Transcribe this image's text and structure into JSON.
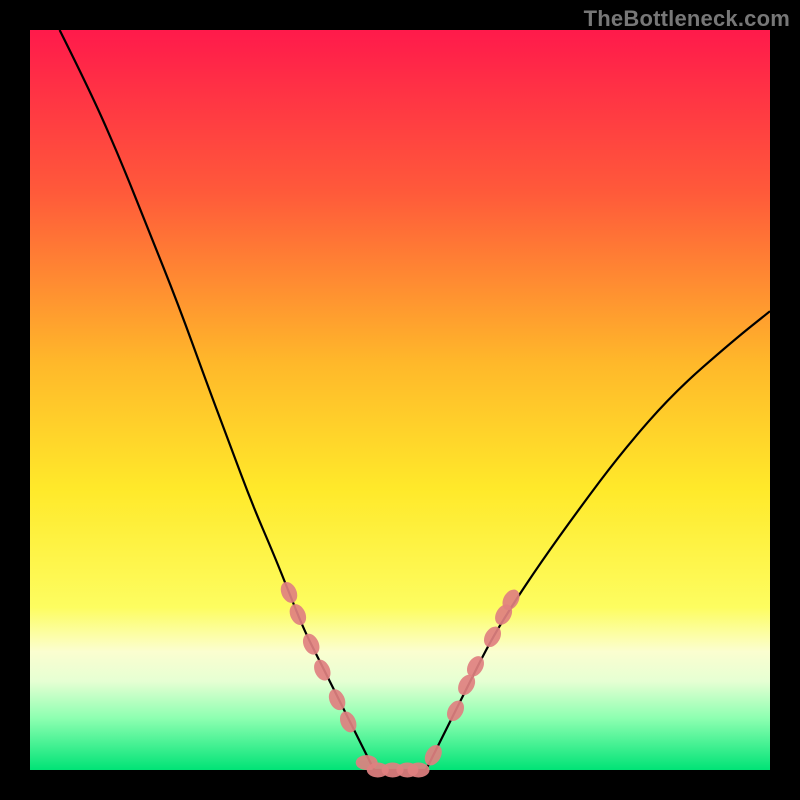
{
  "watermark": "TheBottleneck.com",
  "chart_data": {
    "type": "line",
    "title": "",
    "xlabel": "",
    "ylabel": "",
    "xlim": [
      0,
      100
    ],
    "ylim": [
      0,
      100
    ],
    "grid": false,
    "legend": false,
    "background_gradient": {
      "stops": [
        {
          "offset": 0.0,
          "color": "#ff1a4b"
        },
        {
          "offset": 0.22,
          "color": "#ff5a3a"
        },
        {
          "offset": 0.45,
          "color": "#ffb82a"
        },
        {
          "offset": 0.62,
          "color": "#ffe92a"
        },
        {
          "offset": 0.78,
          "color": "#fdfd60"
        },
        {
          "offset": 0.84,
          "color": "#fbfed0"
        },
        {
          "offset": 0.88,
          "color": "#e6ffd3"
        },
        {
          "offset": 0.93,
          "color": "#8dffb1"
        },
        {
          "offset": 1.0,
          "color": "#00e376"
        }
      ]
    },
    "series": [
      {
        "name": "left-curve",
        "color": "#000000",
        "x": [
          4,
          8,
          12,
          16,
          20,
          24,
          27,
          30,
          33,
          35,
          37,
          39,
          41,
          43,
          45,
          46.5
        ],
        "y": [
          100,
          92,
          83,
          73,
          63,
          52,
          44,
          36,
          29,
          24,
          19,
          15,
          11,
          7,
          3,
          0
        ]
      },
      {
        "name": "right-curve",
        "color": "#000000",
        "x": [
          53.5,
          55,
          57,
          59,
          62,
          65,
          69,
          74,
          80,
          87,
          95,
          100
        ],
        "y": [
          0,
          3,
          7,
          11,
          17,
          22,
          28,
          35,
          43,
          51,
          58,
          62
        ]
      },
      {
        "name": "valley-floor",
        "color": "#000000",
        "x": [
          46.5,
          53.5
        ],
        "y": [
          0,
          0
        ]
      }
    ],
    "markers": {
      "name": "data-points",
      "type": "scatter",
      "shape": "capsule",
      "color": "#e08080",
      "points": [
        {
          "x": 35.0,
          "y": 24.0
        },
        {
          "x": 36.2,
          "y": 21.0
        },
        {
          "x": 38.0,
          "y": 17.0
        },
        {
          "x": 39.5,
          "y": 13.5
        },
        {
          "x": 41.5,
          "y": 9.5
        },
        {
          "x": 43.0,
          "y": 6.5
        },
        {
          "x": 45.5,
          "y": 1.0
        },
        {
          "x": 47.0,
          "y": 0.0
        },
        {
          "x": 49.0,
          "y": 0.0
        },
        {
          "x": 51.0,
          "y": 0.0
        },
        {
          "x": 52.5,
          "y": 0.0
        },
        {
          "x": 54.5,
          "y": 2.0
        },
        {
          "x": 57.5,
          "y": 8.0
        },
        {
          "x": 59.0,
          "y": 11.5
        },
        {
          "x": 60.2,
          "y": 14.0
        },
        {
          "x": 62.5,
          "y": 18.0
        },
        {
          "x": 64.0,
          "y": 21.0
        },
        {
          "x": 65.0,
          "y": 23.0
        }
      ]
    }
  }
}
